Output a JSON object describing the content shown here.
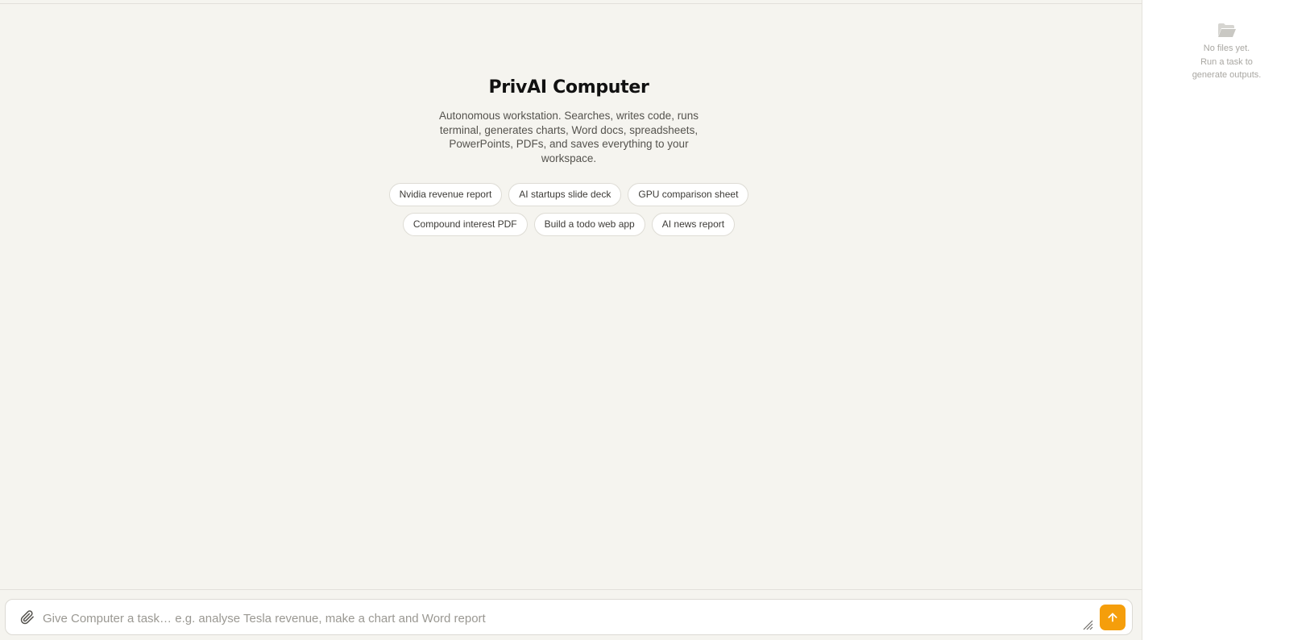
{
  "hero": {
    "title": "PrivAI Computer",
    "description": "Autonomous workstation. Searches, writes code, runs terminal, generates charts, Word docs, spreadsheets, PowerPoints, PDFs, and saves everything to your workspace."
  },
  "suggestions": {
    "row1": [
      "Nvidia revenue report",
      "AI startups slide deck",
      "GPU comparison sheet"
    ],
    "row2": [
      "Compound interest PDF",
      "Build a todo web app",
      "AI news report"
    ]
  },
  "composer": {
    "placeholder": "Give Computer a task… e.g. analyse Tesla revenue, make a chart and Word report",
    "value": "",
    "attach_icon": "paperclip-icon",
    "send_icon": "arrow-up-icon",
    "accent_color": "#f59e0b"
  },
  "files_panel": {
    "icon": "folder-open-icon",
    "empty_lines": [
      "No files yet.",
      "Run a task to",
      "generate outputs."
    ]
  }
}
